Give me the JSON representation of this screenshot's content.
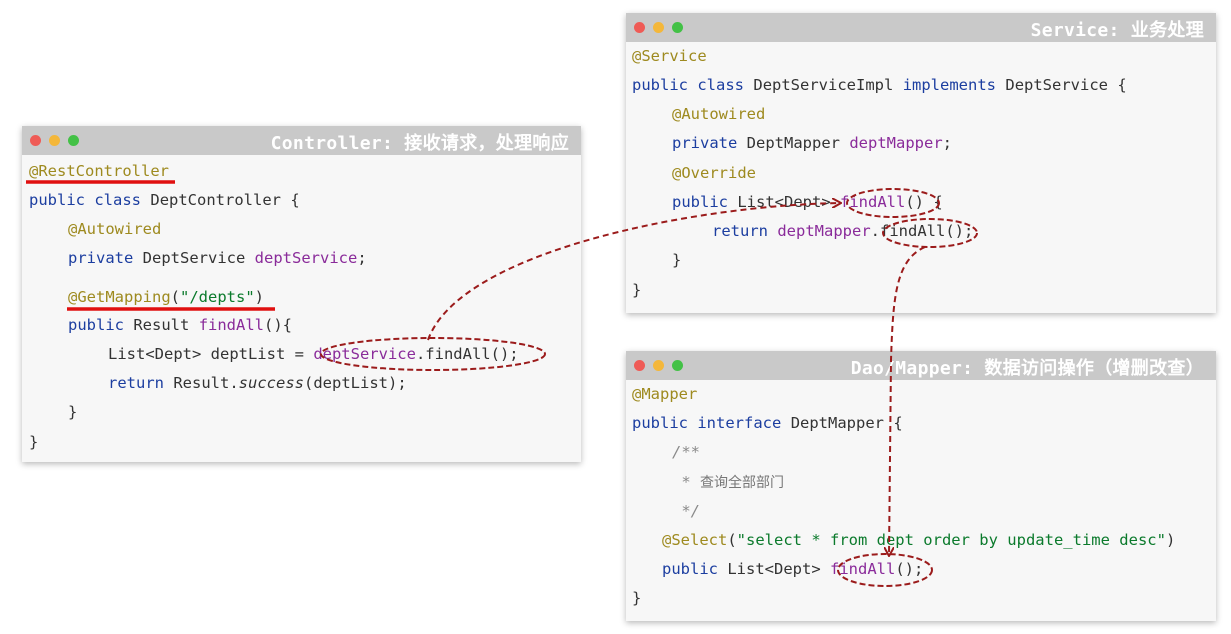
{
  "controller": {
    "title": "Controller: 接收请求，处理响应",
    "l1_ann": "@RestController",
    "l2_kw1": "public",
    "l2_kw2": "class",
    "l2_rest": "DeptController {",
    "l3_ann": "@Autowired",
    "l4_kw": "private",
    "l4_type": "DeptService",
    "l4_field": "deptService",
    "l4_end": ";",
    "l5_ann": "@GetMapping",
    "l5_open": "(",
    "l5_str": "\"/depts\"",
    "l5_close": ")",
    "l6_kw": "public",
    "l6_type": "Result",
    "l6_method": "findAll",
    "l6_end": "(){",
    "l7_type": "List<Dept> deptList = ",
    "l7_field": "deptService",
    "l7_call": ".findAll();",
    "l8_kw": "return",
    "l8_mid": "Result.",
    "l8_it": "success",
    "l8_end": "(deptList);",
    "l9": "}",
    "l10": "}"
  },
  "service": {
    "title": "Service: 业务处理",
    "l1_ann": "@Service",
    "l2_kw1": "public",
    "l2_kw2": "class",
    "l2_name": "DeptServiceImpl",
    "l2_kw3": "implements",
    "l2_end": "DeptService {",
    "l3_ann": "@Autowired",
    "l4_kw": "private",
    "l4_type": "DeptMapper",
    "l4_field": "deptMapper",
    "l4_end": ";",
    "l5_ann": "@Override",
    "l6_kw": "public",
    "l6_type": "List<Dept>",
    "l6_method": "findAll",
    "l6_end": "() {",
    "l7_kw": "return",
    "l7_field": "deptMapper",
    "l7_call": ".findAll();",
    "l8": "}",
    "l9": "}"
  },
  "mapper": {
    "title": "Dao/Mapper: 数据访问操作（增删改查）",
    "l1_ann": "@Mapper",
    "l2_kw1": "public",
    "l2_kw2": "interface",
    "l2_end": "DeptMapper {",
    "l3_cmt": "/**",
    "l4_star": " * ",
    "l4_zh": "查询全部部门",
    "l5_cmt": " */",
    "l6_ann": "@Select",
    "l6_open": "(",
    "l6_str": "\"select * from dept order by update_time desc\"",
    "l6_close": ")",
    "l7_kw": "public",
    "l7_type": "List<Dept>",
    "l7_method": "findAll",
    "l7_end": "();",
    "l8": "}"
  },
  "colors": {
    "annotation": "#9e8a1f",
    "keyword": "#1c3ea0",
    "field": "#8a2b9a",
    "string": "#0b7a2c",
    "highlight_red": "#9b1b1b",
    "underline_red": "#e01010"
  }
}
